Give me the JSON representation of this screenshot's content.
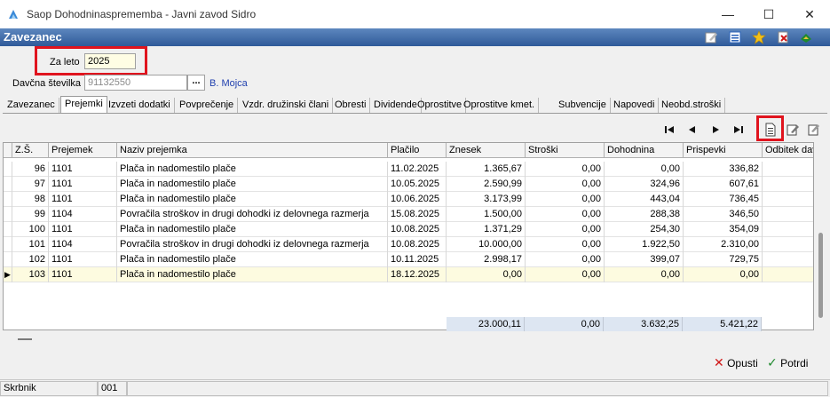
{
  "window": {
    "title": "Saop Dohodninasprememba - Javni zavod Sidro"
  },
  "header": {
    "title": "Zavezanec"
  },
  "form": {
    "year_label": "Za leto",
    "year_value": "2025",
    "tax_label": "Davčna številka",
    "tax_value": "91132550",
    "lookup_label": "...",
    "person_name": "B. Mojca"
  },
  "tabs": [
    "Zavezanec",
    "Prejemki",
    "Izvzeti dodatki",
    "Povprečenje",
    "Vzdr. družinski člani",
    "Obresti",
    "Dividende",
    "Oprostitve",
    "Oprostitve kmet.",
    "Subvencije",
    "Napovedi",
    "Neobd.stroški"
  ],
  "active_tab": "Prejemki",
  "grid": {
    "columns": [
      "Z.Š.",
      "Prejemek",
      "Naziv prejemka",
      "Plačilo",
      "Znesek",
      "Stroški",
      "Dohodnina",
      "Prispevki",
      "Odbitek dav"
    ],
    "rows": [
      [
        "96",
        "1101",
        "Plača in nadomestilo plače",
        "11.02.2025",
        "1.365,67",
        "0,00",
        "0,00",
        "336,82"
      ],
      [
        "97",
        "1101",
        "Plača in nadomestilo plače",
        "10.05.2025",
        "2.590,99",
        "0,00",
        "324,96",
        "607,61"
      ],
      [
        "98",
        "1101",
        "Plača in nadomestilo plače",
        "10.06.2025",
        "3.173,99",
        "0,00",
        "443,04",
        "736,45"
      ],
      [
        "99",
        "1104",
        "Povračila stroškov in drugi dohodki iz delovnega razmerja",
        "15.08.2025",
        "1.500,00",
        "0,00",
        "288,38",
        "346,50"
      ],
      [
        "100",
        "1101",
        "Plača in nadomestilo plače",
        "10.08.2025",
        "1.371,29",
        "0,00",
        "254,30",
        "354,09"
      ],
      [
        "101",
        "1104",
        "Povračila stroškov in drugi dohodki iz delovnega razmerja",
        "10.08.2025",
        "10.000,00",
        "0,00",
        "1.922,50",
        "2.310,00"
      ],
      [
        "102",
        "1101",
        "Plača in nadomestilo plače",
        "10.11.2025",
        "2.998,17",
        "0,00",
        "399,07",
        "729,75"
      ],
      [
        "103",
        "1101",
        "Plača in nadomestilo plače",
        "18.12.2025",
        "0,00",
        "0,00",
        "0,00",
        "0,00"
      ]
    ],
    "totals": {
      "znesek": "23.000,11",
      "stroski": "0,00",
      "dohodnina": "3.632,25",
      "prispevki": "5.421,22"
    }
  },
  "buttons": {
    "cancel": "Opusti",
    "confirm": "Potrdi"
  },
  "status": {
    "user": "Skrbnik",
    "code": "001"
  },
  "colors": {
    "header": "#2f5a99",
    "highlight": "#e0141e",
    "selected_row": "#fdfbe0",
    "totals_bg": "#dde6f2"
  }
}
